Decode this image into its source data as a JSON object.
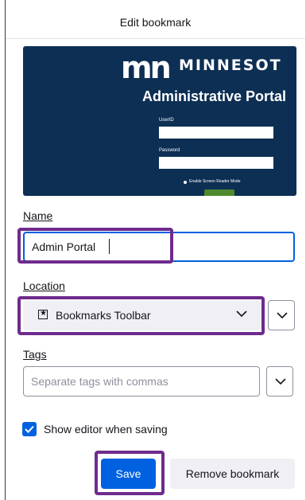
{
  "dialog": {
    "title": "Edit bookmark"
  },
  "preview": {
    "logo_mark": "mn",
    "logo_word": "MINNESOT",
    "portal_title": "Administrative Portal",
    "userid_label": "UserID",
    "password_label": "Password",
    "screen_reader_label": "Enable Screen Reader Mode",
    "background_color": "#0d2f54",
    "button_color": "#4e8a2e"
  },
  "name_field": {
    "label": "Name",
    "value": "Admin Portal"
  },
  "location_field": {
    "label": "Location",
    "selected": "Bookmarks Toolbar",
    "icon": "star-icon"
  },
  "tags_field": {
    "label": "Tags",
    "placeholder": "Separate tags with commas"
  },
  "show_editor": {
    "label": "Show editor when saving",
    "checked": true
  },
  "buttons": {
    "save": "Save",
    "remove": "Remove bookmark"
  },
  "colors": {
    "accent": "#0061e0",
    "highlight": "#6f2b8e"
  }
}
